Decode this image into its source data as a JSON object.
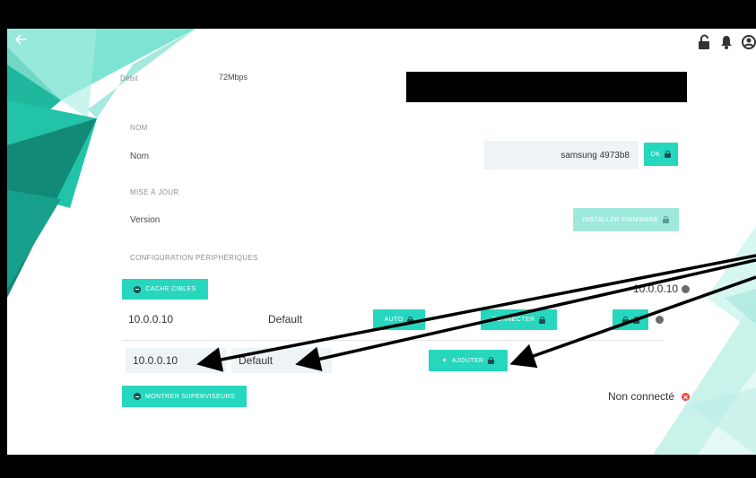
{
  "header": {
    "back_icon": "arrow-left-icon",
    "icons": [
      "lock-open-icon",
      "bell-icon",
      "account-circle-icon"
    ]
  },
  "debit": {
    "label": "Débit",
    "value": "72Mbps"
  },
  "nom": {
    "section": "NOM",
    "label": "Nom",
    "value": "samsung 4973b8",
    "ok_label": "OK"
  },
  "update": {
    "section": "MISE À JOUR",
    "label": "Version",
    "install_label": "INSTALLER FIRMWARE"
  },
  "devices": {
    "section": "CONFIGURATION PÉRIPHÉRIQUES",
    "hide_targets_label": "CACHE CIBLES",
    "target_ip_top": "10.0.0.10",
    "row": {
      "ip": "10.0.0.10",
      "name": "Default",
      "auto_label": "AUTO",
      "connect_label": "CONNECTER"
    },
    "new_ip_value": "10.0.0.10",
    "new_name_value": "Default",
    "add_label": "AJOUTER",
    "show_supervisors_label": "MONTRER SUPERVISEURS",
    "status": "Non connecté"
  },
  "colors": {
    "accent": "#26d7be",
    "accent_faded": "#9fe9dc",
    "deco_dark": "#138a78",
    "deco_mid": "#1fb89f",
    "deco_light": "#6fe0cc",
    "error": "#e8443a"
  }
}
